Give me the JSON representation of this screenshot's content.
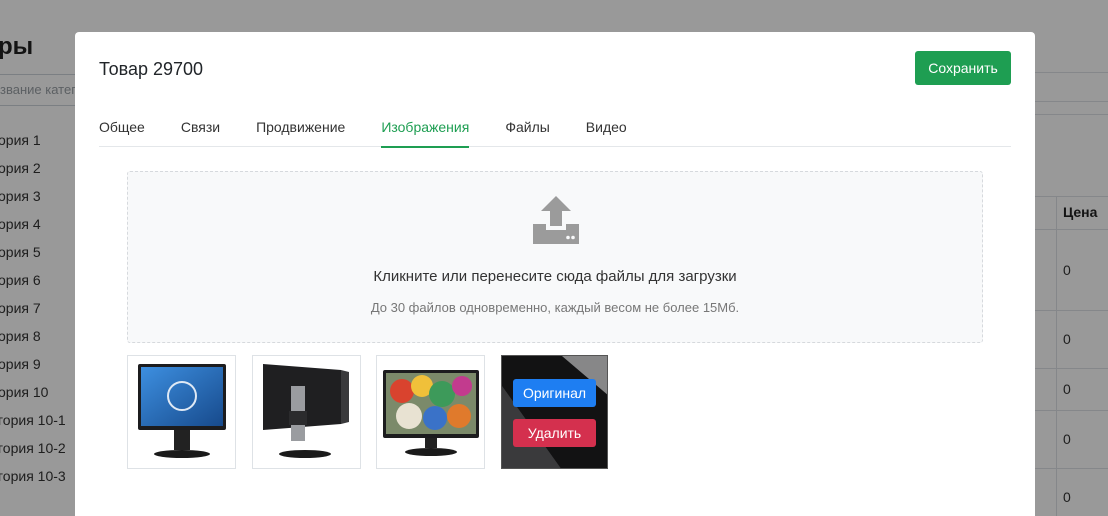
{
  "background": {
    "page_title_fragment": "ры",
    "category_placeholder": "звание катег",
    "categories": [
      "ория 1",
      "ория 2",
      "ория 3",
      "ория 4",
      "ория 5",
      "ория 6",
      "ория 7",
      "ория 8",
      "ория 9",
      "ория 10",
      "гория 10-1",
      "гория 10-2",
      "гория 10-3"
    ],
    "price_header": "Цена",
    "prices": [
      "0",
      "0",
      "0",
      "0",
      "0"
    ]
  },
  "modal": {
    "title": "Товар 29700",
    "save_label": "Сохранить",
    "tabs": [
      {
        "label": "Общее",
        "active": false
      },
      {
        "label": "Связи",
        "active": false
      },
      {
        "label": "Продвижение",
        "active": false
      },
      {
        "label": "Изображения",
        "active": true
      },
      {
        "label": "Файлы",
        "active": false
      },
      {
        "label": "Видео",
        "active": false
      }
    ],
    "dropzone": {
      "icon": "upload-icon",
      "main_text": "Кликните или перенесите сюда файлы для загрузки",
      "sub_text": "До 30 файлов одновременно, каждый весом не более 15Мб."
    },
    "images": [
      {
        "name": "monitor-front"
      },
      {
        "name": "monitor-back"
      },
      {
        "name": "monitor-colorful-screen"
      },
      {
        "name": "monitor-side-dark",
        "hovered": true
      }
    ],
    "image_actions": {
      "original_label": "Оригинал",
      "delete_label": "Удалить"
    }
  },
  "colors": {
    "accent_green": "#1e9e52",
    "primary_blue": "#1e7ef2",
    "danger_red": "#d4304e"
  }
}
